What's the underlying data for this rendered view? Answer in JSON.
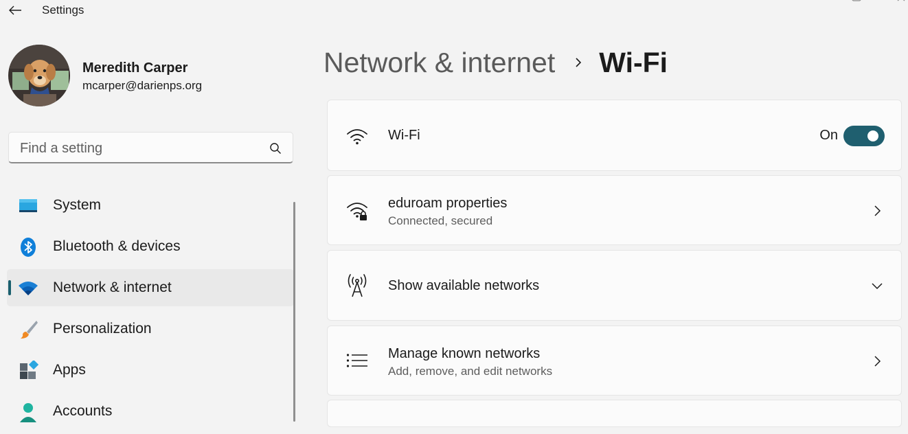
{
  "window": {
    "title": "Settings"
  },
  "profile": {
    "name": "Meredith Carper",
    "email": "mcarper@darienps.org"
  },
  "search": {
    "placeholder": "Find a setting"
  },
  "nav": {
    "items": [
      {
        "label": "System",
        "icon": "system-icon"
      },
      {
        "label": "Bluetooth & devices",
        "icon": "bluetooth-icon"
      },
      {
        "label": "Network & internet",
        "icon": "wifi-icon",
        "selected": true
      },
      {
        "label": "Personalization",
        "icon": "paintbrush-icon"
      },
      {
        "label": "Apps",
        "icon": "apps-icon"
      },
      {
        "label": "Accounts",
        "icon": "person-icon"
      }
    ]
  },
  "header": {
    "parent": "Network & internet",
    "current": "Wi-Fi"
  },
  "cards": {
    "wifi": {
      "title": "Wi-Fi",
      "state": "On",
      "enabled": true
    },
    "properties": {
      "title": "eduroam properties",
      "subtitle": "Connected, secured"
    },
    "available": {
      "title": "Show available networks"
    },
    "known": {
      "title": "Manage known networks",
      "subtitle": "Add, remove, and edit networks"
    }
  },
  "colors": {
    "accent": "#1f5f6f",
    "background": "#f3f3f3",
    "card": "#fbfbfb"
  }
}
